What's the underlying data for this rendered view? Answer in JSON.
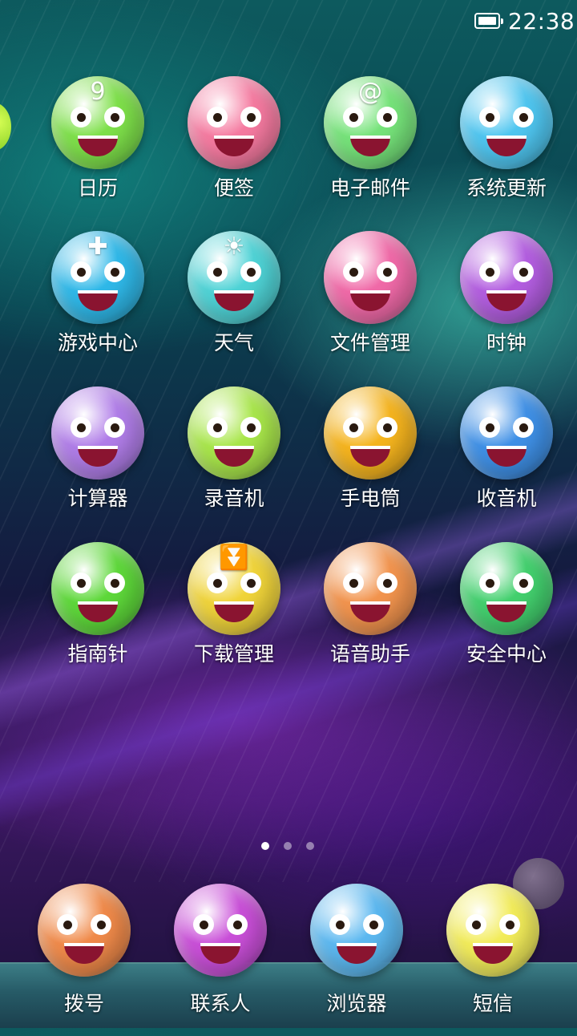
{
  "status_bar": {
    "time": "22:38",
    "battery_icon": "battery-full-icon"
  },
  "grid": [
    {
      "label": "日历",
      "icon": "calendar-icon",
      "color": "#7ee04a",
      "glyph": "9"
    },
    {
      "label": "便签",
      "icon": "notes-icon",
      "color": "#f57aa0",
      "glyph": ""
    },
    {
      "label": "电子邮件",
      "icon": "email-icon",
      "color": "#76e37a",
      "glyph": "@"
    },
    {
      "label": "系统更新",
      "icon": "system-update-icon",
      "color": "#4fc6f0",
      "glyph": ""
    },
    {
      "label": "游戏中心",
      "icon": "game-center-icon",
      "color": "#2fb8e8",
      "glyph": "✚"
    },
    {
      "label": "天气",
      "icon": "weather-icon",
      "color": "#4fd3d6",
      "glyph": "☀"
    },
    {
      "label": "文件管理",
      "icon": "file-manager-icon",
      "color": "#f06aa8",
      "glyph": ""
    },
    {
      "label": "时钟",
      "icon": "clock-icon",
      "color": "#b35ee0",
      "glyph": ""
    },
    {
      "label": "计算器",
      "icon": "calculator-icon",
      "color": "#b07de8",
      "glyph": ""
    },
    {
      "label": "录音机",
      "icon": "recorder-icon",
      "color": "#a8e64a",
      "glyph": ""
    },
    {
      "label": "手电筒",
      "icon": "flashlight-icon",
      "color": "#f5b41e",
      "glyph": ""
    },
    {
      "label": "收音机",
      "icon": "radio-icon",
      "color": "#3f90e6",
      "glyph": ""
    },
    {
      "label": "指南针",
      "icon": "compass-icon",
      "color": "#5ed83a",
      "glyph": ""
    },
    {
      "label": "下载管理",
      "icon": "download-manager-icon",
      "color": "#f0d43a",
      "glyph": "⏬"
    },
    {
      "label": "语音助手",
      "icon": "voice-assistant-icon",
      "color": "#f2944e",
      "glyph": ""
    },
    {
      "label": "安全中心",
      "icon": "security-center-icon",
      "color": "#43d06e",
      "glyph": ""
    }
  ],
  "page_indicator": {
    "count": 3,
    "active": 0
  },
  "dock": [
    {
      "label": "拨号",
      "icon": "phone-dialer-icon",
      "color": "#f08a4a"
    },
    {
      "label": "联系人",
      "icon": "contacts-icon",
      "color": "#c94fd8"
    },
    {
      "label": "浏览器",
      "icon": "browser-icon",
      "color": "#5cb8f0"
    },
    {
      "label": "短信",
      "icon": "messages-icon",
      "color": "#f2ec5a"
    }
  ]
}
